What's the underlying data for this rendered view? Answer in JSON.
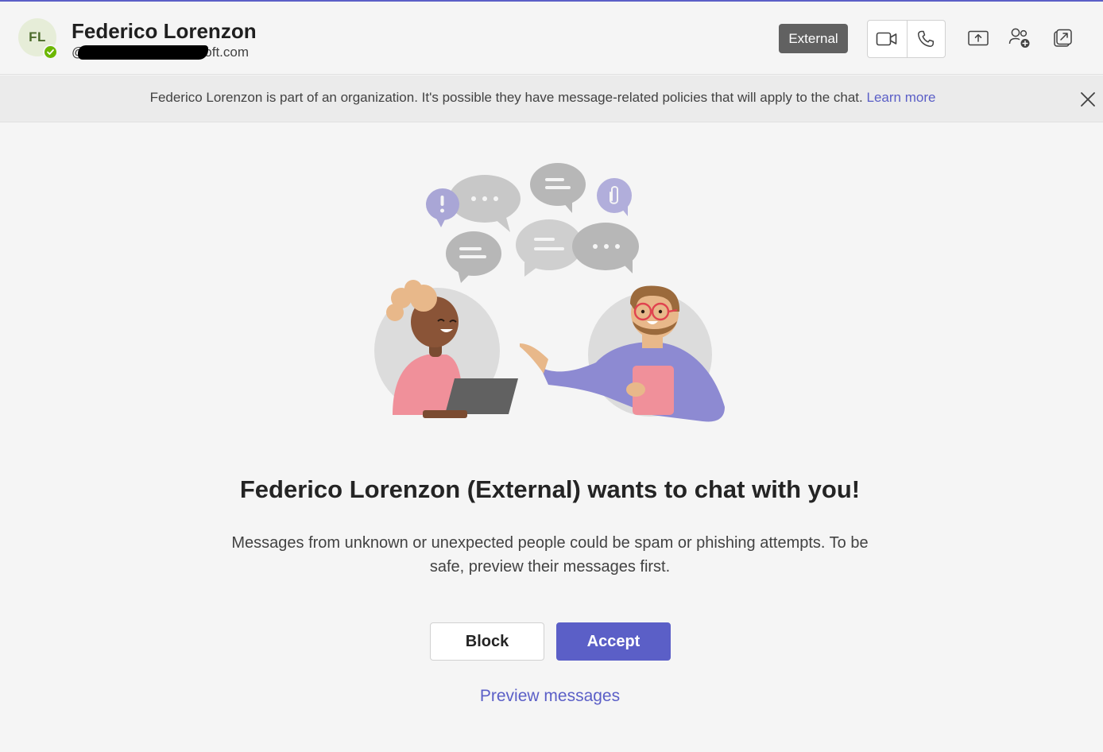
{
  "colors": {
    "brand": "#5b5fc7",
    "presence_available": "#6bb700",
    "badge_bg": "#616161"
  },
  "header": {
    "avatar_initials": "FL",
    "contact_name": "Federico Lorenzon",
    "contact_email": "@",
    "contact_email_tail": "oft.com",
    "external_badge": "External",
    "icons": {
      "video": "video-call-icon",
      "audio": "audio-call-icon",
      "share": "share-screen-icon",
      "add_people": "add-people-icon",
      "popout": "pop-out-chat-icon",
      "presence": "available-check-icon"
    }
  },
  "banner": {
    "text": "Federico Lorenzon is part of an organization. It's possible they have message-related policies that will apply to the chat.",
    "link": "Learn more",
    "close_icon": "close-icon"
  },
  "main": {
    "headline": "Federico Lorenzon (External) wants to chat with you!",
    "subtext": "Messages from unknown or unexpected people could be spam or phishing attempts. To be safe, preview their messages first.",
    "block_label": "Block",
    "accept_label": "Accept",
    "preview_label": "Preview messages"
  }
}
